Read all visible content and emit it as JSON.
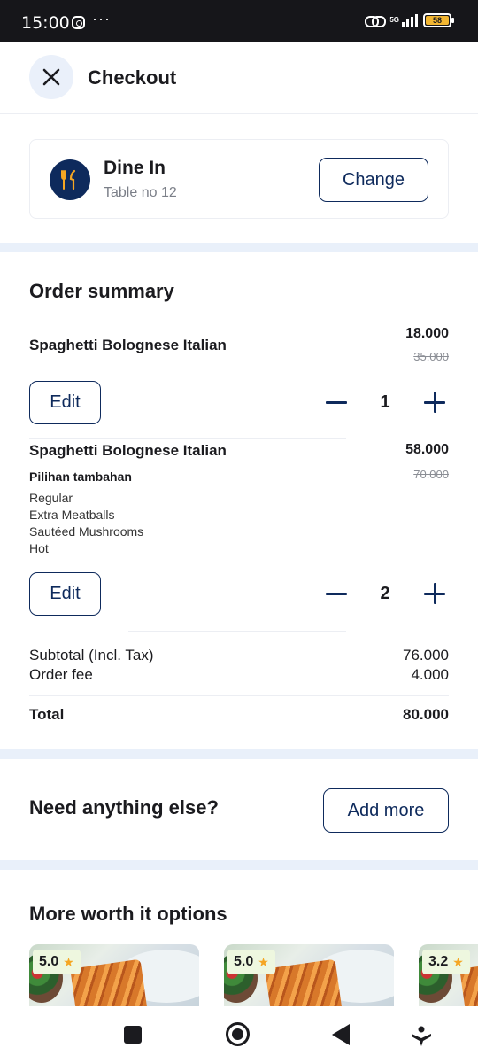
{
  "status_bar": {
    "time": "15:00",
    "more": "···",
    "network": "5G",
    "battery": "58"
  },
  "header": {
    "title": "Checkout",
    "close_icon": "close-icon"
  },
  "dine_in": {
    "title": "Dine In",
    "table": "Table no 12",
    "change_label": "Change",
    "icon": "utensils-icon"
  },
  "order_summary": {
    "title": "Order summary",
    "items": [
      {
        "name": "Spaghetti Bolognese Italian",
        "price": "18.000",
        "old_price": "35.000",
        "edit_label": "Edit",
        "quantity": "1",
        "addons_label": "",
        "addons": []
      },
      {
        "name": "Spaghetti Bolognese Italian",
        "price": "58.000",
        "old_price": "70.000",
        "edit_label": "Edit",
        "quantity": "2",
        "addons_label": "Pilihan tambahan",
        "addons": [
          "Regular",
          "Extra Meatballs",
          "Sautéed Mushrooms",
          "Hot"
        ]
      }
    ],
    "subtotal_label": "Subtotal (Incl. Tax)",
    "subtotal_value": "76.000",
    "fee_label": "Order fee",
    "fee_value": "4.000",
    "total_label": "Total",
    "total_value": "80.000"
  },
  "upsell": {
    "title": "Need anything else?",
    "add_more_label": "Add more"
  },
  "more_options": {
    "title": "More worth it options",
    "cards": [
      {
        "rating": "5.0"
      },
      {
        "rating": "5.0"
      },
      {
        "rating": "3.2"
      }
    ]
  },
  "colors": {
    "primary": "#0e2a5c",
    "divider": "#e9f0fa",
    "star": "#f5a623",
    "rating_bg": "#eef7df"
  }
}
